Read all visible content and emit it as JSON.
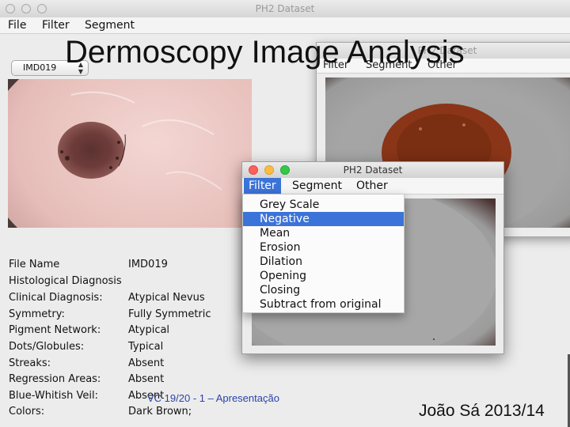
{
  "main_window": {
    "title": "PH2 Dataset",
    "menu": [
      "File",
      "Filter",
      "Segment"
    ],
    "image_select": {
      "value": "IMD019"
    },
    "info": [
      {
        "label": "File Name",
        "value": "IMD019"
      },
      {
        "label": "Histological Diagnosis",
        "value": ""
      },
      {
        "label": "Clinical Diagnosis:",
        "value": "Atypical Nevus"
      },
      {
        "label": "Symmetry:",
        "value": "Fully Symmetric"
      },
      {
        "label": "Pigment Network:",
        "value": "Atypical"
      },
      {
        "label": "Dots/Globules:",
        "value": "Typical"
      },
      {
        "label": "Streaks:",
        "value": "Absent"
      },
      {
        "label": "Regression Areas:",
        "value": "Absent"
      },
      {
        "label": "Blue-Whitish Veil:",
        "value": "Absent"
      },
      {
        "label": "Colors:",
        "value": "Dark Brown;"
      }
    ]
  },
  "segment_window": {
    "title": "PH2 Dataset",
    "menu": [
      "Filter",
      "Segment",
      "Other"
    ]
  },
  "negative_window": {
    "title": "PH2 Dataset",
    "menu": [
      "Filter",
      "Segment",
      "Other"
    ],
    "filter_menu": {
      "items": [
        "Grey Scale",
        "Negative",
        "Mean",
        "Erosion",
        "Dilation",
        "Opening",
        "Closing",
        "Subtract from original"
      ],
      "selected": "Negative"
    }
  },
  "slide": {
    "title": "Dermoscopy Image Analysis",
    "footer_left": "VC 19/20 - 1 – Apresentação",
    "footer_right": "João Sá 2013/14"
  },
  "colors": {
    "selection_blue": "#3b73d8",
    "footer_blue": "#2a44a8",
    "traffic_red": "#fc605c",
    "traffic_yellow": "#fdbc40",
    "traffic_green": "#34c84a"
  },
  "icons": [
    "select-arrows-icon",
    "close-window-icon",
    "minimize-window-icon",
    "zoom-window-icon"
  ]
}
